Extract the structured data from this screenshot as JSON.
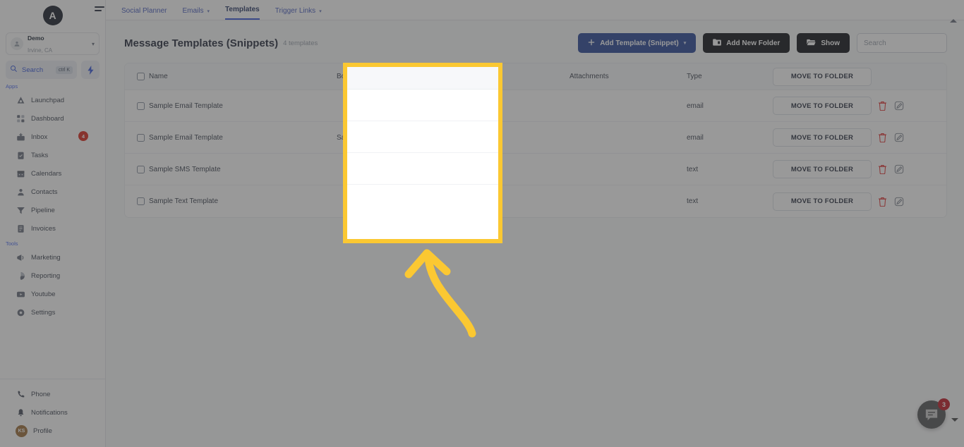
{
  "sidebar": {
    "brand_initial": "A",
    "workspace": {
      "name": "Demo",
      "location": "Irvine, CA",
      "chevron": "chevron-down-icon"
    },
    "search": {
      "label": "Search",
      "shortcut": "ctrl K",
      "bolt": "bolt-icon"
    },
    "group_apps_label": "Apps",
    "apps": [
      {
        "label": "Launchpad",
        "icon": "launchpad-icon",
        "badge": ""
      },
      {
        "label": "Dashboard",
        "icon": "dashboard-icon",
        "badge": ""
      },
      {
        "label": "Inbox",
        "icon": "inbox-icon",
        "badge": "4"
      },
      {
        "label": "Tasks",
        "icon": "tasks-icon",
        "badge": ""
      },
      {
        "label": "Calendars",
        "icon": "calendar-icon",
        "badge": ""
      },
      {
        "label": "Contacts",
        "icon": "contacts-icon",
        "badge": ""
      },
      {
        "label": "Pipeline",
        "icon": "pipeline-icon",
        "badge": ""
      },
      {
        "label": "Invoices",
        "icon": "invoices-icon",
        "badge": ""
      }
    ],
    "group_tools_label": "Tools",
    "tools": [
      {
        "label": "Marketing",
        "icon": "megaphone-icon",
        "badge": ""
      },
      {
        "label": "Reporting",
        "icon": "pie-chart-icon",
        "badge": ""
      },
      {
        "label": "Youtube",
        "icon": "youtube-icon",
        "badge": ""
      },
      {
        "label": "Settings",
        "icon": "gear-icon",
        "badge": ""
      }
    ],
    "bottom": [
      {
        "label": "Phone",
        "icon": "phone-icon"
      },
      {
        "label": "Notifications",
        "icon": "bell-icon"
      },
      {
        "label": "Profile",
        "icon": "avatar-icon",
        "initials": "KS"
      }
    ]
  },
  "topbar": {
    "menu_icon": "hamburger-icon",
    "tabs": [
      {
        "label": "Social Planner",
        "has_caret": false,
        "active": false
      },
      {
        "label": "Emails",
        "has_caret": true,
        "active": false
      },
      {
        "label": "Templates",
        "has_caret": false,
        "active": true
      },
      {
        "label": "Trigger Links",
        "has_caret": true,
        "active": false
      }
    ]
  },
  "page": {
    "title": "Message Templates (Snippets)",
    "count_label": "4 templates",
    "buttons": {
      "add_template": "Add Template (Snippet)",
      "add_template_icon": "plus-icon",
      "add_template_caret": "chevron-down-icon",
      "add_new_folder": "Add New Folder",
      "add_new_folder_icon": "folder-add-icon",
      "show": "Show",
      "show_icon": "folder-open-icon"
    },
    "search_placeholder": "Search"
  },
  "table": {
    "headers": {
      "name": "Name",
      "body": "Body",
      "attachments": "Attachments",
      "type": "Type",
      "move_to_folder": "MOVE TO FOLDER"
    },
    "rows": [
      {
        "name": "Sample Email Template",
        "body": "",
        "attachments": "",
        "type": "email",
        "action": "MOVE TO FOLDER",
        "delete_icon": "trash-icon",
        "edit_icon": "edit-icon"
      },
      {
        "name": "Sample Email Template",
        "body": "Sample Description Template",
        "attachments": "",
        "type": "email",
        "action": "MOVE TO FOLDER",
        "delete_icon": "trash-icon",
        "edit_icon": "edit-icon"
      },
      {
        "name": "Sample SMS Template",
        "body": "",
        "attachments": "",
        "type": "text",
        "action": "MOVE TO FOLDER",
        "delete_icon": "trash-icon",
        "edit_icon": "edit-icon"
      },
      {
        "name": "Sample Text Template",
        "body": "",
        "attachments": "",
        "type": "text",
        "action": "MOVE TO FOLDER",
        "delete_icon": "trash-icon",
        "edit_icon": "edit-icon"
      }
    ]
  },
  "chat_widget": {
    "icon": "chat-bubble-icon",
    "badge": "3",
    "caret": "caret-down-icon"
  },
  "annotation": {
    "highlight_color": "#fbc832",
    "arrow_icon": "curved-up-arrow-icon",
    "highlighted_column": "Body"
  },
  "colors": {
    "accent_blue": "#2c4a9a",
    "dark_button": "#14161c",
    "badge_red": "#d92d20",
    "highlight_yellow": "#fbc832"
  }
}
